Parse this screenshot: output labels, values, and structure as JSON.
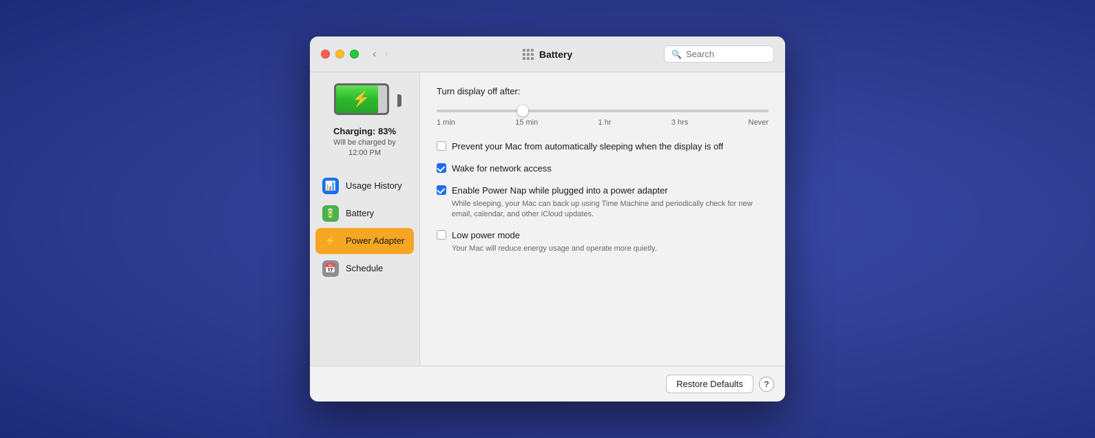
{
  "window": {
    "title": "Battery"
  },
  "titlebar": {
    "close_label": "",
    "minimize_label": "",
    "maximize_label": "",
    "back_label": "‹",
    "forward_label": "›",
    "grid_label": "⊞",
    "search_placeholder": "Search"
  },
  "sidebar": {
    "charging_status": "Charging: 83%",
    "charging_sub_line1": "Will be charged by",
    "charging_sub_line2": "12:00 PM",
    "nav_items": [
      {
        "id": "usage-history",
        "label": "Usage History",
        "icon": "📊",
        "icon_class": "icon-blue",
        "active": false
      },
      {
        "id": "battery",
        "label": "Battery",
        "icon": "🔋",
        "icon_class": "icon-green",
        "active": false
      },
      {
        "id": "power-adapter",
        "label": "Power Adapter",
        "icon": "⚡",
        "icon_class": "icon-orange",
        "active": true
      },
      {
        "id": "schedule",
        "label": "Schedule",
        "icon": "📅",
        "icon_class": "icon-gray",
        "active": false
      }
    ]
  },
  "detail": {
    "slider_label": "Turn display off after:",
    "slider_value": 25,
    "slider_labels": [
      "1 min",
      "15 min",
      "1 hr",
      "3 hrs",
      "Never"
    ],
    "options": [
      {
        "id": "prevent-sleep",
        "checked": false,
        "main": "Prevent your Mac from automatically sleeping when the display is off",
        "sub": ""
      },
      {
        "id": "wake-network",
        "checked": true,
        "main": "Wake for network access",
        "sub": ""
      },
      {
        "id": "enable-power-nap",
        "checked": true,
        "main": "Enable Power Nap while plugged into a power adapter",
        "sub": "While sleeping, your Mac can back up using Time Machine and periodically check for new email, calendar, and other iCloud updates."
      },
      {
        "id": "low-power-mode",
        "checked": false,
        "main": "Low power mode",
        "sub": "Your Mac will reduce energy usage and operate more quietly."
      }
    ]
  },
  "footer": {
    "restore_label": "Restore Defaults",
    "help_label": "?"
  }
}
